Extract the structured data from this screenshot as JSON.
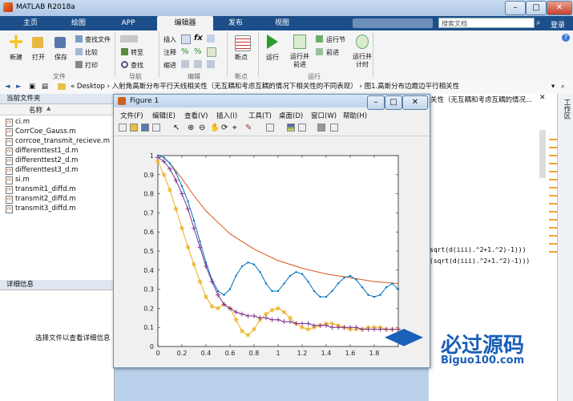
{
  "window": {
    "title": "MATLAB R2018a"
  },
  "tabs": [
    "主页",
    "绘图",
    "APP",
    "编辑器",
    "发布",
    "视图"
  ],
  "search": {
    "placeholder": "搜索文档"
  },
  "login": "登录",
  "ribbon": {
    "new": "新建",
    "open": "打开",
    "save": "保存",
    "find_files": "查找文件",
    "compare": "比较",
    "print": "打印",
    "goto": "转至",
    "find": "查找",
    "insert": "插入",
    "comment": "注释",
    "indent": "缩进",
    "breakpoints": "断点",
    "run": "运行",
    "run_advance": "运行并\n前进",
    "run_section": "运行节",
    "advance": "前进",
    "run_time": "运行并\n计时",
    "groups": {
      "file": "文件",
      "navigate": "导航",
      "edit": "编辑",
      "breakpoints": "断点",
      "run": "运行"
    }
  },
  "address": {
    "path": "«  Desktop  ›  入射角高斯分布平行天线相关性（无互耦和考虑互耦的情况下相关性的不同表现）  ›  图1.高斯分布边霞边平行相关性"
  },
  "editor_tab": "关性（无互耦和考虑互耦的情况...",
  "workspace_label": "工作区",
  "current_folder": {
    "header": "当前文件夹",
    "col_name": "名称",
    "files": [
      "ci.m",
      "CorrCoe_Gauss.m",
      "corrcoe_transmit_recieve.m",
      "differenttest1_d.m",
      "differenttest2_d.m",
      "differenttest3_d.m",
      "si.m",
      "transmit1_diffd.m",
      "transmit2_diffd.m",
      "transmit3_diffd.m"
    ]
  },
  "details": {
    "header": "详细信息",
    "placeholder": "选择文件以查看详细信息"
  },
  "code_lines": [
    "sqrt(d(iii).^2+1.^2)-1)))",
    "(sqrt(d(iii).^2+1.^2)-1)))"
  ],
  "figure": {
    "title": "Figure 1",
    "menu": [
      "文件(F)",
      "编辑(E)",
      "查看(V)",
      "插入(I)",
      "工具(T)",
      "桌面(D)",
      "窗口(W)",
      "帮助(H)"
    ]
  },
  "watermark": {
    "cn": "必过源码",
    "en": "Biguo100.com"
  },
  "colors": {
    "blue": "#0072bd",
    "orange": "#d95319",
    "yellow": "#edb120",
    "purple": "#7e2f8e"
  },
  "chart_data": {
    "type": "line",
    "xlim": [
      0,
      2
    ],
    "ylim": [
      0,
      1
    ],
    "xticks": [
      0,
      0.2,
      0.4,
      0.6,
      0.8,
      1,
      1.2,
      1.4,
      1.6,
      1.8
    ],
    "yticks": [
      0,
      0.1,
      0.2,
      0.3,
      0.4,
      0.5,
      0.6,
      0.7,
      0.8,
      0.9,
      1
    ],
    "xtick_labels": [
      "0",
      "0.2",
      "0.4",
      "0.6",
      "0.8",
      "1",
      "1.2",
      "1.4",
      "1.6",
      "1.8"
    ],
    "ytick_labels": [
      "0",
      "0.1",
      "0.2",
      "0.3",
      "0.4",
      "0.5",
      "0.6",
      "0.7",
      "0.8",
      "0.9",
      "1"
    ],
    "series": [
      {
        "color": "#d95319",
        "marker": "none",
        "x": [
          0,
          0.05,
          0.1,
          0.2,
          0.3,
          0.4,
          0.5,
          0.6,
          0.7,
          0.8,
          0.9,
          1.0,
          1.2,
          1.4,
          1.6,
          1.8,
          2.0
        ],
        "y": [
          1,
          0.99,
          0.96,
          0.88,
          0.79,
          0.71,
          0.65,
          0.59,
          0.55,
          0.51,
          0.48,
          0.45,
          0.41,
          0.38,
          0.36,
          0.34,
          0.33
        ]
      },
      {
        "color": "#0072bd",
        "marker": "dot",
        "x": [
          0,
          0.05,
          0.1,
          0.15,
          0.2,
          0.25,
          0.3,
          0.35,
          0.4,
          0.45,
          0.5,
          0.55,
          0.6,
          0.65,
          0.7,
          0.75,
          0.8,
          0.85,
          0.9,
          0.95,
          1.0,
          1.05,
          1.1,
          1.15,
          1.2,
          1.25,
          1.3,
          1.35,
          1.4,
          1.45,
          1.5,
          1.55,
          1.6,
          1.65,
          1.7,
          1.75,
          1.8,
          1.85,
          1.9,
          1.95,
          2.0
        ],
        "y": [
          1,
          0.99,
          0.96,
          0.91,
          0.84,
          0.76,
          0.66,
          0.55,
          0.44,
          0.35,
          0.29,
          0.27,
          0.3,
          0.37,
          0.42,
          0.44,
          0.43,
          0.39,
          0.33,
          0.29,
          0.29,
          0.33,
          0.37,
          0.39,
          0.38,
          0.34,
          0.29,
          0.26,
          0.26,
          0.29,
          0.33,
          0.36,
          0.37,
          0.35,
          0.31,
          0.27,
          0.26,
          0.27,
          0.31,
          0.33,
          0.3
        ]
      },
      {
        "color": "#edb120",
        "marker": "star",
        "x": [
          0,
          0.05,
          0.1,
          0.15,
          0.2,
          0.25,
          0.3,
          0.35,
          0.4,
          0.45,
          0.5,
          0.55,
          0.6,
          0.65,
          0.7,
          0.75,
          0.8,
          0.85,
          0.9,
          0.95,
          1.0,
          1.05,
          1.1,
          1.15,
          1.2,
          1.25,
          1.3,
          1.35,
          1.4,
          1.45,
          1.5,
          1.55,
          1.6,
          1.65,
          1.7,
          1.75,
          1.8,
          1.85,
          1.9,
          1.95,
          2.0
        ],
        "y": [
          0.97,
          0.9,
          0.82,
          0.72,
          0.62,
          0.52,
          0.43,
          0.34,
          0.26,
          0.21,
          0.2,
          0.22,
          0.2,
          0.14,
          0.08,
          0.06,
          0.09,
          0.14,
          0.17,
          0.19,
          0.2,
          0.18,
          0.15,
          0.12,
          0.1,
          0.09,
          0.1,
          0.11,
          0.12,
          0.12,
          0.11,
          0.1,
          0.09,
          0.09,
          0.09,
          0.1,
          0.1,
          0.1,
          0.09,
          0.09,
          0.09
        ]
      },
      {
        "color": "#7e2f8e",
        "marker": "plus",
        "x": [
          0,
          0.05,
          0.1,
          0.15,
          0.2,
          0.25,
          0.3,
          0.35,
          0.4,
          0.45,
          0.5,
          0.55,
          0.6,
          0.65,
          0.7,
          0.75,
          0.8,
          0.85,
          0.9,
          0.95,
          1.0,
          1.05,
          1.1,
          1.15,
          1.2,
          1.25,
          1.3,
          1.35,
          1.4,
          1.45,
          1.5,
          1.55,
          1.6,
          1.65,
          1.7,
          1.75,
          1.8,
          1.85,
          1.9,
          1.95,
          2.0
        ],
        "y": [
          0.99,
          0.97,
          0.93,
          0.87,
          0.8,
          0.72,
          0.62,
          0.52,
          0.42,
          0.34,
          0.27,
          0.22,
          0.2,
          0.18,
          0.17,
          0.16,
          0.16,
          0.15,
          0.15,
          0.14,
          0.14,
          0.13,
          0.13,
          0.12,
          0.12,
          0.12,
          0.11,
          0.11,
          0.11,
          0.1,
          0.1,
          0.1,
          0.1,
          0.1,
          0.09,
          0.09,
          0.09,
          0.09,
          0.09,
          0.09,
          0.09
        ]
      }
    ]
  }
}
